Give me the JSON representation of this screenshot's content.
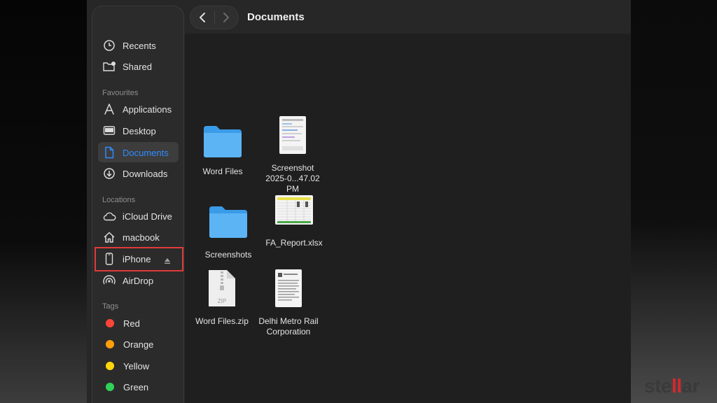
{
  "window": {
    "title": "Documents"
  },
  "toolbar": {
    "back_icon": "chevron-left-icon",
    "forward_icon": "chevron-right-icon"
  },
  "sidebar": {
    "top": [
      {
        "label": "Recents",
        "icon": "clock-icon"
      },
      {
        "label": "Shared",
        "icon": "shared-folder-icon"
      }
    ],
    "favourites_heading": "Favourites",
    "favourites": [
      {
        "label": "Applications",
        "icon": "applications-icon"
      },
      {
        "label": "Desktop",
        "icon": "desktop-icon"
      },
      {
        "label": "Documents",
        "icon": "document-icon",
        "selected": true
      },
      {
        "label": "Downloads",
        "icon": "download-icon"
      }
    ],
    "locations_heading": "Locations",
    "locations": [
      {
        "label": "iCloud Drive",
        "icon": "cloud-icon"
      },
      {
        "label": "macbook",
        "icon": "home-icon"
      },
      {
        "label": "iPhone",
        "icon": "iphone-icon",
        "highlighted": true
      },
      {
        "label": "AirDrop",
        "icon": "airdrop-icon"
      }
    ],
    "tags_heading": "Tags",
    "tags": [
      {
        "label": "Red",
        "color": "#ff453a"
      },
      {
        "label": "Orange",
        "color": "#ff9f0a"
      },
      {
        "label": "Yellow",
        "color": "#ffd60a"
      },
      {
        "label": "Green",
        "color": "#30d158"
      }
    ]
  },
  "files": [
    {
      "name": "Word Files",
      "type": "folder"
    },
    {
      "name_line1": "Screenshot",
      "name_line2": "2025-0...47.02 PM",
      "type": "image"
    },
    {
      "name": "Screenshots",
      "type": "folder"
    },
    {
      "name": "FA_Report.xlsx",
      "type": "spreadsheet"
    },
    {
      "name": "Word Files.zip",
      "type": "zip",
      "badge": "ZIP"
    },
    {
      "name_line1": "Delhi Metro Rail",
      "name_line2": "Corporation",
      "type": "document"
    }
  ],
  "accent_color": "#0a84ff",
  "brand": {
    "prefix": "ste",
    "highlight": "ll",
    "suffix": "ar"
  }
}
